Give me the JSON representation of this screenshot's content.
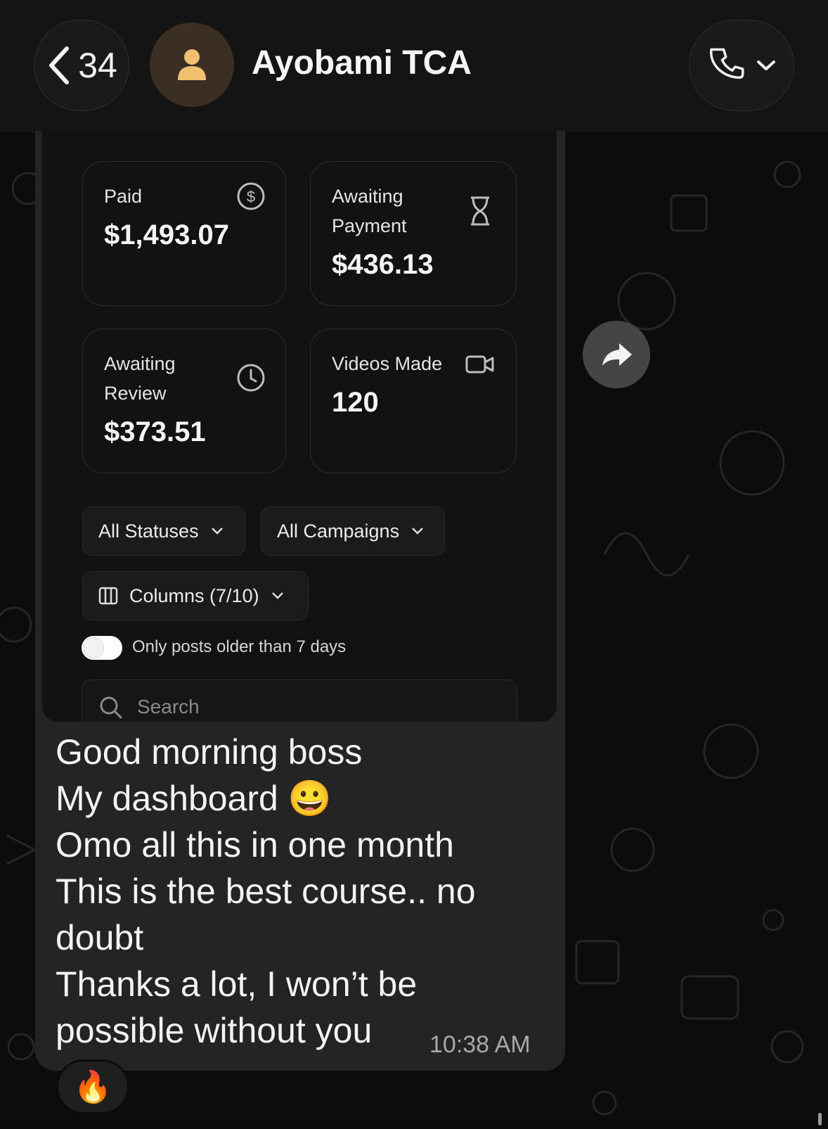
{
  "header": {
    "back_count": "34",
    "contact_name": "Ayobami TCA"
  },
  "dashboard": {
    "cards": [
      {
        "label": "Paid",
        "value": "$1,493.07",
        "icon": "dollar-circle-icon"
      },
      {
        "label": "Awaiting Payment",
        "value": "$436.13",
        "icon": "hourglass-icon"
      },
      {
        "label": "Awaiting Review",
        "value": "$373.51",
        "icon": "clock-icon"
      },
      {
        "label": "Videos Made",
        "value": "120",
        "icon": "video-camera-icon"
      }
    ],
    "filters": {
      "statuses": "All Statuses",
      "campaigns": "All Campaigns",
      "columns": "Columns (7/10)"
    },
    "toggle_label": "Only posts older than 7 days",
    "toggle_on": false,
    "search_placeholder": "Search"
  },
  "message": {
    "lines": [
      "Good morning boss",
      "My dashboard",
      "Omo all this in one month",
      "This is the best course.. no",
      "doubt",
      "Thanks a lot, I won’t be",
      "possible without you"
    ],
    "emoji": "😀",
    "timestamp": "10:38 AM",
    "reaction": "🔥"
  },
  "colors": {
    "header_bg": "#141414",
    "bubble_bg": "#242424",
    "avatar_bg": "#3a2f22",
    "avatar_icon": "#f0c070"
  }
}
